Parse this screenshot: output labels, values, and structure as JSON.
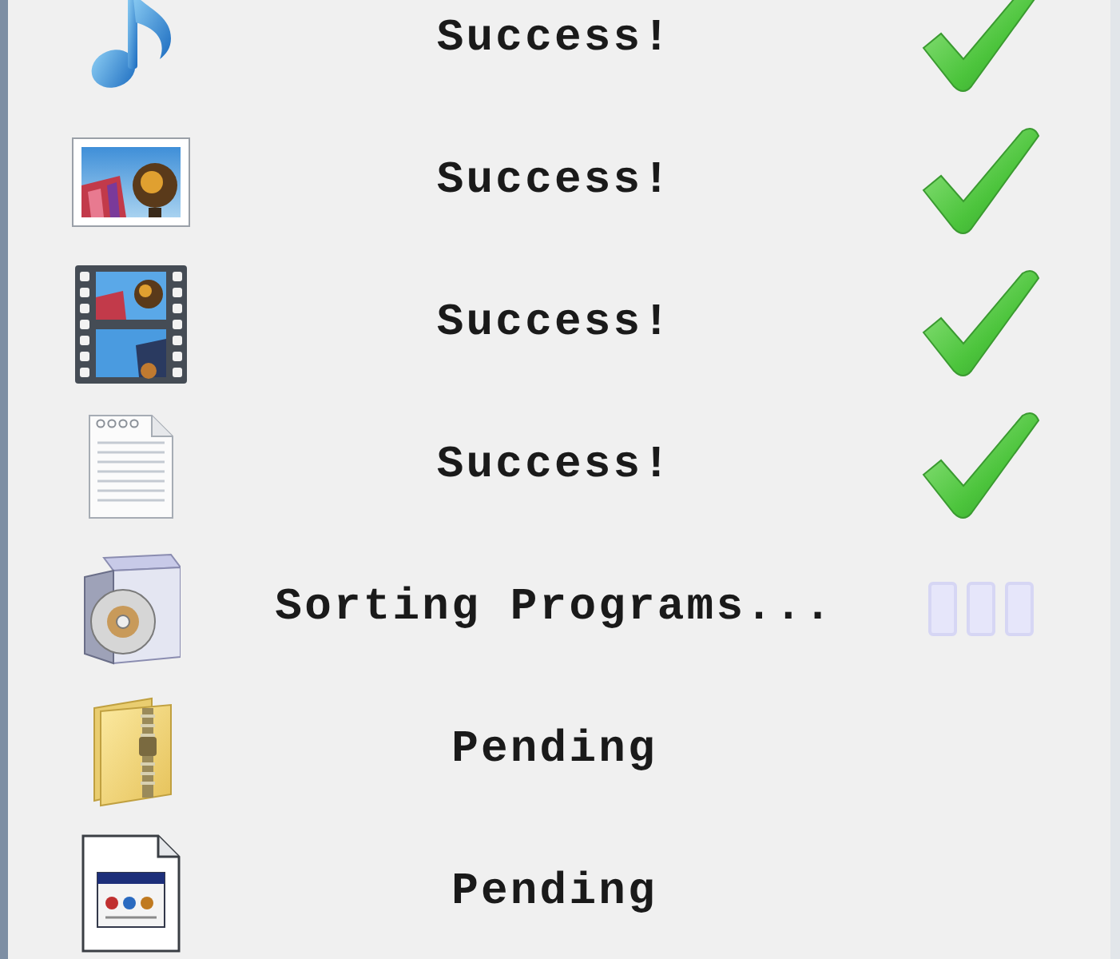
{
  "rows": [
    {
      "label": "Success!",
      "kind": "success"
    },
    {
      "label": "Success!",
      "kind": "success"
    },
    {
      "label": "Success!",
      "kind": "success"
    },
    {
      "label": "Success!",
      "kind": "success"
    },
    {
      "label": "Sorting Programs...",
      "kind": "progress"
    },
    {
      "label": "Pending",
      "kind": "pending"
    },
    {
      "label": "Pending",
      "kind": "pending"
    }
  ]
}
